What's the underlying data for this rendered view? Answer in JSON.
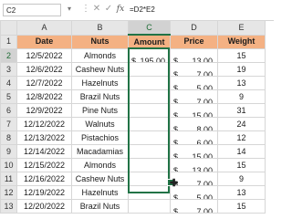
{
  "formula_bar": {
    "name_box": "C2",
    "dropdown_icon": "chevron-down-icon",
    "icons": [
      "more-options-icon",
      "cancel-icon",
      "enter-checkmark-icon",
      "fx-icon"
    ],
    "cancel_glyph": "✕",
    "enter_glyph": "✓",
    "fx_glyph": "fx",
    "formula": "=D2*E2"
  },
  "sheet": {
    "columns": [
      "A",
      "B",
      "C",
      "D",
      "E"
    ],
    "active_column": "C",
    "active_row": "2",
    "header_row": {
      "row": "1",
      "cells": [
        "Date",
        "Nuts",
        "Amount",
        "Price",
        "Weight"
      ]
    },
    "rows": [
      {
        "row": "2",
        "date": "12/5/2022",
        "nut": "Almonds",
        "amount_cur": "$",
        "amount": "195.00",
        "price_cur": "$",
        "price": "13.00",
        "weight": "15"
      },
      {
        "row": "3",
        "date": "12/6/2022",
        "nut": "Cashew Nuts",
        "amount_cur": "",
        "amount": "",
        "price_cur": "$",
        "price": "7.00",
        "weight": "19"
      },
      {
        "row": "4",
        "date": "12/7/2022",
        "nut": "Hazelnuts",
        "amount_cur": "",
        "amount": "",
        "price_cur": "$",
        "price": "5.00",
        "weight": "13"
      },
      {
        "row": "5",
        "date": "12/8/2022",
        "nut": "Brazil Nuts",
        "amount_cur": "",
        "amount": "",
        "price_cur": "$",
        "price": "7.00",
        "weight": "9"
      },
      {
        "row": "6",
        "date": "12/9/2022",
        "nut": "Pine Nuts",
        "amount_cur": "",
        "amount": "",
        "price_cur": "$",
        "price": "15.00",
        "weight": "31"
      },
      {
        "row": "7",
        "date": "12/12/2022",
        "nut": "Walnuts",
        "amount_cur": "",
        "amount": "",
        "price_cur": "$",
        "price": "8.00",
        "weight": "24"
      },
      {
        "row": "8",
        "date": "12/13/2022",
        "nut": "Pistachios",
        "amount_cur": "",
        "amount": "",
        "price_cur": "$",
        "price": "6.00",
        "weight": "12"
      },
      {
        "row": "9",
        "date": "12/14/2022",
        "nut": "Macadamias",
        "amount_cur": "",
        "amount": "",
        "price_cur": "$",
        "price": "15.00",
        "weight": "14"
      },
      {
        "row": "10",
        "date": "12/15/2022",
        "nut": "Almonds",
        "amount_cur": "",
        "amount": "",
        "price_cur": "$",
        "price": "13.00",
        "weight": "15"
      },
      {
        "row": "11",
        "date": "12/16/2022",
        "nut": "Cashew Nuts",
        "amount_cur": "",
        "amount": "",
        "price_cur": "$",
        "price": "7.00",
        "weight": "9"
      },
      {
        "row": "12",
        "date": "12/19/2022",
        "nut": "Hazelnuts",
        "amount_cur": "",
        "amount": "",
        "price_cur": "$",
        "price": "5.00",
        "weight": "13"
      },
      {
        "row": "13",
        "date": "12/20/2022",
        "nut": "Brazil Nuts",
        "amount_cur": "",
        "amount": "",
        "price_cur": "$",
        "price": "7.00",
        "weight": "15"
      }
    ],
    "colors": {
      "header_fill": "#f4b183",
      "selection_border": "#217346"
    },
    "cursor_icon": "fill-handle-plus-icon"
  }
}
